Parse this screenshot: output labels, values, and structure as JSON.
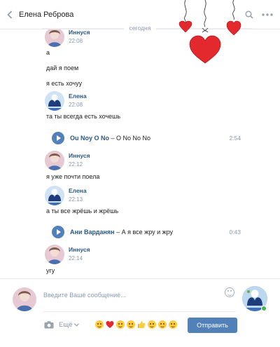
{
  "header": {
    "title": "Елена Реброва",
    "back_icon": "chevron-left-icon",
    "search_icon": "search-icon",
    "more_icon": "more-dots-icon"
  },
  "day_separator": "сегодня",
  "messages": [
    {
      "author": "Иннуся",
      "time": "22:08",
      "lines": [
        "а",
        "дай я поем",
        "я есть хочуу"
      ]
    },
    {
      "author": "Елена",
      "time": "22:08",
      "lines": [
        "та ты всегда есть хочешь"
      ],
      "audio": {
        "artist": "Ou Noy O No",
        "title": "O No No No",
        "duration": "2:54"
      }
    },
    {
      "author": "Иннуся",
      "time": "22:12",
      "lines": [
        "я уже почти поела"
      ]
    },
    {
      "author": "Елена",
      "time": "22:13",
      "lines": [
        "а ты все жрёшь и жрёшь"
      ],
      "audio": {
        "artist": "Ани Варданян",
        "title": "А я все жру и жру",
        "duration": "0:43"
      }
    },
    {
      "author": "Иннуся",
      "time": "22:14",
      "lines": [
        "угу"
      ]
    }
  ],
  "audio_separator": " – ",
  "composer": {
    "placeholder": "Введите Ваше сообщение...",
    "more_label": "Ещё",
    "send_label": "Отправить",
    "emojis": [
      "laughing-face",
      "heart",
      "heart-eyes-face",
      "grinning-face",
      "thumbs-up",
      "grimacing-face",
      "smirk-face",
      "smile-face"
    ]
  },
  "colors": {
    "accent": "#5181b8",
    "name": "#2a5885",
    "muted": "#8a9ab0",
    "heart": "#e3292e",
    "online": "#4bb34b"
  }
}
